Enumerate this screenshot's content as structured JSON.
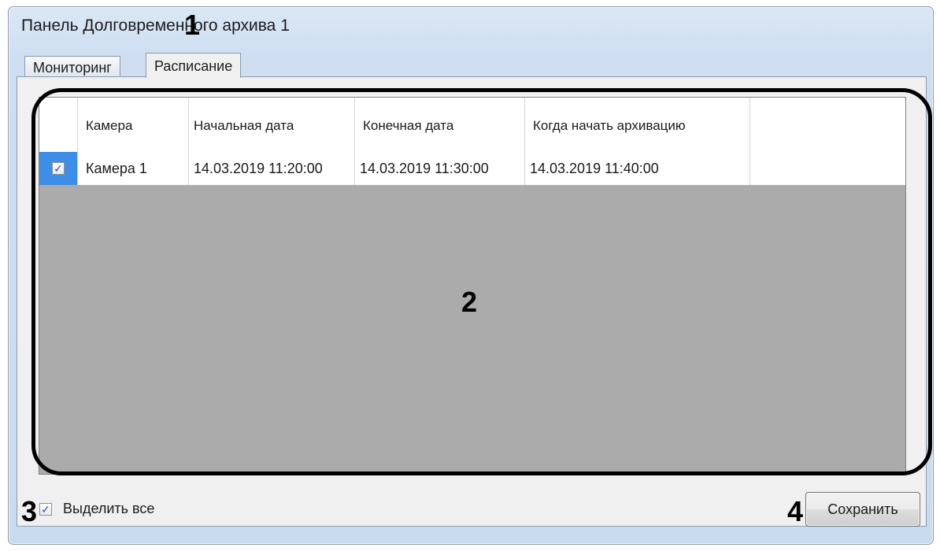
{
  "window": {
    "title": "Панель Долговременного архива 1"
  },
  "tabs": [
    {
      "label": "Мониторинг",
      "active": false
    },
    {
      "label": "Расписание",
      "active": true
    }
  ],
  "table": {
    "columns": [
      "",
      "Камера",
      "Начальная дата",
      "Конечная дата",
      "Когда начать архивацию",
      ""
    ],
    "rows": [
      {
        "checked": true,
        "camera": "Камера 1",
        "start_date": "14.03.2019 11:20:00",
        "end_date": "14.03.2019 11:30:00",
        "archive_start": "14.03.2019 11:40:00"
      }
    ]
  },
  "select_all": {
    "label": "Выделить все",
    "checked": true
  },
  "save_button": {
    "label": "Сохранить"
  },
  "annotations": {
    "m1": "1",
    "m2": "2",
    "m3": "3",
    "m4": "4"
  },
  "colors": {
    "window_frame": "#cfdff1",
    "grid_background": "#ababab",
    "selected_cell": "#3d8ee8"
  }
}
